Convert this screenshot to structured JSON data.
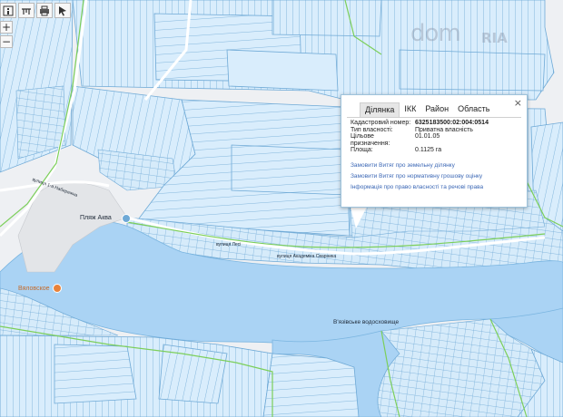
{
  "toolbar": {
    "icons": [
      "info-icon",
      "ruler-icon",
      "print-icon",
      "pointer-icon"
    ]
  },
  "zoom": {
    "plus": "+",
    "minus": "−"
  },
  "watermark": {
    "text": "dom",
    "brand": "RIA"
  },
  "popup": {
    "close": "×",
    "tabs": [
      "Ділянка",
      "ІКК",
      "Район",
      "Область"
    ],
    "active_tab": 0,
    "fields": [
      {
        "label": "Кадастровий номер:",
        "value": "6325183500:02:004:0514"
      },
      {
        "label": "Тип власності:",
        "value": "Приватна власність"
      },
      {
        "label": "Цільове призначення:",
        "value": "01.01.05"
      },
      {
        "label": "Площа:",
        "value": "0.1125 га"
      }
    ],
    "links": [
      "Замовити Витяг про земельну ділянку",
      "Замовити Витяг про нормативну грошову оцінку",
      "Інформація про право власності та речові права"
    ]
  },
  "labels": {
    "beach": "Пляж Аква",
    "village": "Вяловское",
    "reservoir": "В'язівське водосховище",
    "street1": "вулиця 1-а Набережна",
    "street2": "вулиця Лесі",
    "street3": "вулиця Академіка Сварника"
  },
  "colors": {
    "water": "#aad3f4",
    "parcel_fill": "#d8ecfb",
    "parcel_stroke": "#6ea9d6",
    "boundary": "#7ccf5a",
    "link": "#3b67b5"
  }
}
